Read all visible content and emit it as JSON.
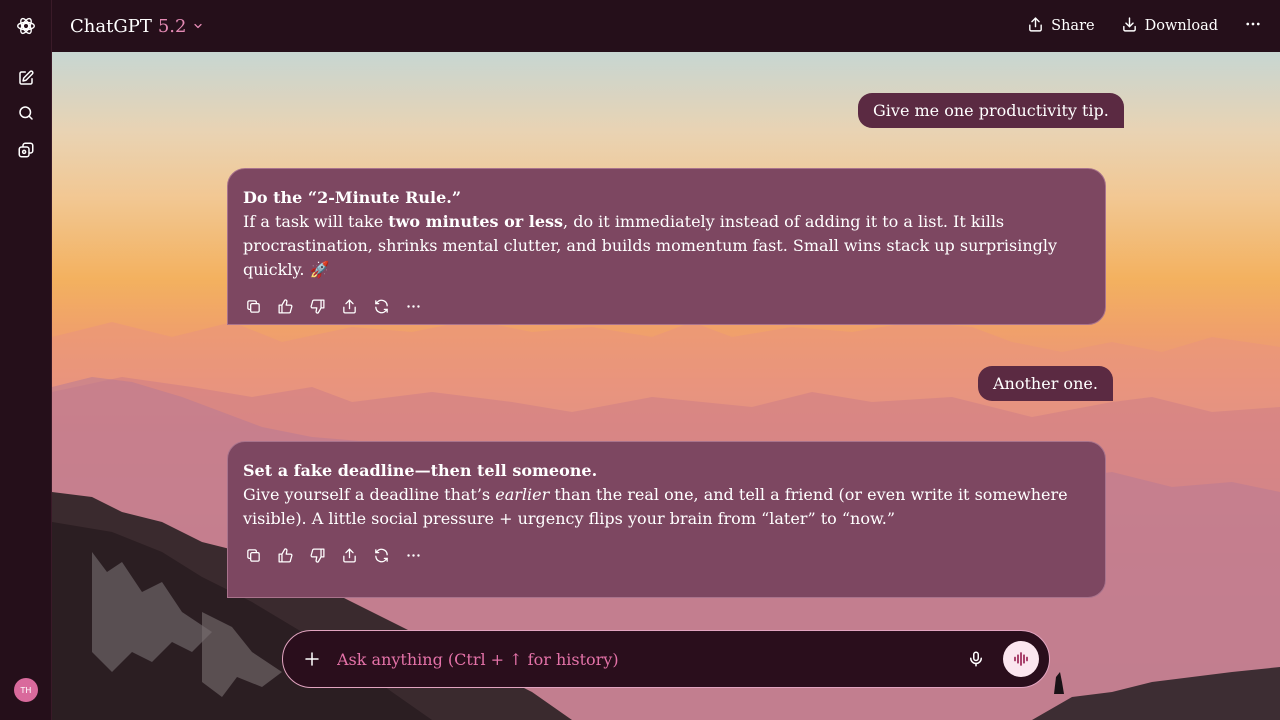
{
  "sidebar": {
    "avatar_initials": "TH"
  },
  "header": {
    "model_name": "ChatGPT",
    "model_version": "5.2",
    "share_label": "Share",
    "download_label": "Download"
  },
  "messages": {
    "user1": "Give me one productivity tip.",
    "assistant1": {
      "title": "Do the “2-Minute Rule.”",
      "body_1": "If a task will take ",
      "body_bold": "two minutes or less",
      "body_2": ", do it immediately instead of adding it to a list. It kills procrastination, shrinks mental clutter, and builds momentum fast. Small wins stack up surprisingly quickly. 🚀"
    },
    "user2": "Another one.",
    "assistant2": {
      "title": "Set a fake deadline—then tell someone.",
      "body_1": "Give yourself a deadline that’s ",
      "body_italic": "earlier",
      "body_2": " than the real one, and tell a friend (or even write it somewhere visible). A little social pressure + urgency flips your brain from “later” to “now.”"
    }
  },
  "composer": {
    "placeholder": "Ask anything (Ctrl + ↑ for history)"
  },
  "colors": {
    "accent": "#e472a8",
    "header_bg": "#250f1a",
    "assistant_bubble": "#7d4761",
    "user_bubble": "#5b2a42"
  },
  "icons": [
    "openai-logo-icon",
    "new-chat-icon",
    "search-icon",
    "library-icon",
    "chevron-down-icon",
    "share-icon",
    "download-icon",
    "more-icon",
    "copy-icon",
    "thumbs-up-icon",
    "thumbs-down-icon",
    "share-message-icon",
    "regenerate-icon",
    "plus-icon",
    "microphone-icon",
    "voice-mode-icon"
  ]
}
